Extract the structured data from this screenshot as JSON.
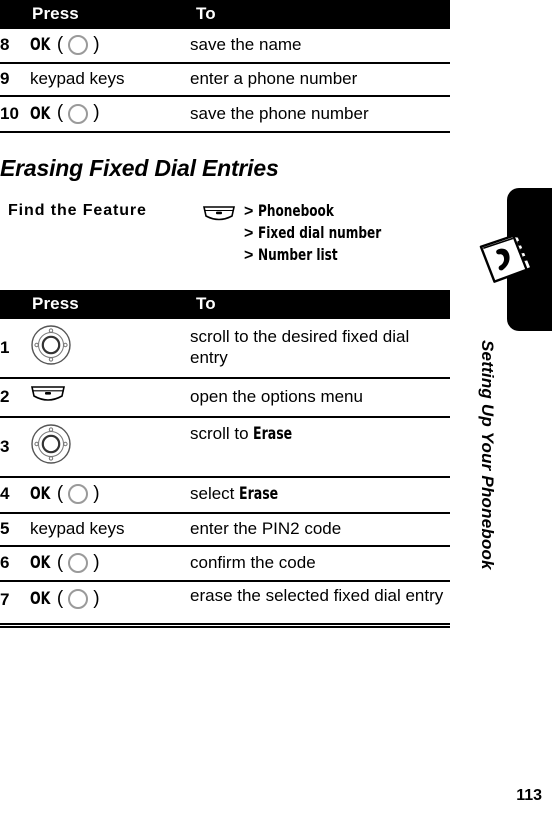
{
  "page": {
    "number": "113",
    "section_title": "Erasing Fixed Dial Entries"
  },
  "sidebar": {
    "tab_label": "Setting Up Your Phonebook",
    "icon": "phonebook-icon"
  },
  "table_top": {
    "headers": {
      "press": "Press",
      "to": "To"
    },
    "rows": [
      {
        "num": "8",
        "press_type": "ok",
        "press_label": "OK",
        "to": "save the name"
      },
      {
        "num": "9",
        "press_type": "text",
        "press_label": "keypad keys",
        "to": "enter a phone number"
      },
      {
        "num": "10",
        "press_type": "ok",
        "press_label": "OK",
        "to": "save the phone number"
      }
    ]
  },
  "find_the_feature": {
    "label": "Find the Feature",
    "icon": "menu-key-icon",
    "items": [
      {
        "arrow": ">",
        "text": "Phonebook"
      },
      {
        "arrow": ">",
        "text": "Fixed dial number"
      },
      {
        "arrow": ">",
        "text": "Number list"
      }
    ]
  },
  "table_main": {
    "headers": {
      "press": "Press",
      "to": "To"
    },
    "rows": [
      {
        "num": "1",
        "press_type": "nav",
        "press_label": "",
        "to": "scroll to the desired fixed dial entry",
        "to_bold": ""
      },
      {
        "num": "2",
        "press_type": "menu",
        "press_label": "",
        "to": "open the options menu",
        "to_bold": ""
      },
      {
        "num": "3",
        "press_type": "nav",
        "press_label": "",
        "to": "scroll to ",
        "to_bold": "Erase"
      },
      {
        "num": "4",
        "press_type": "ok",
        "press_label": "OK",
        "to": "select ",
        "to_bold": "Erase"
      },
      {
        "num": "5",
        "press_type": "text",
        "press_label": "keypad keys",
        "to": "enter the PIN2 code",
        "to_bold": ""
      },
      {
        "num": "6",
        "press_type": "ok",
        "press_label": "OK",
        "to": "confirm the code",
        "to_bold": ""
      },
      {
        "num": "7",
        "press_type": "ok",
        "press_label": "OK",
        "to": "erase the selected fixed dial entry",
        "to_bold": ""
      }
    ]
  },
  "colors": {
    "header_bg": "#000000",
    "header_fg": "#ffffff",
    "rule": "#000000",
    "page_bg": "#ffffff"
  }
}
